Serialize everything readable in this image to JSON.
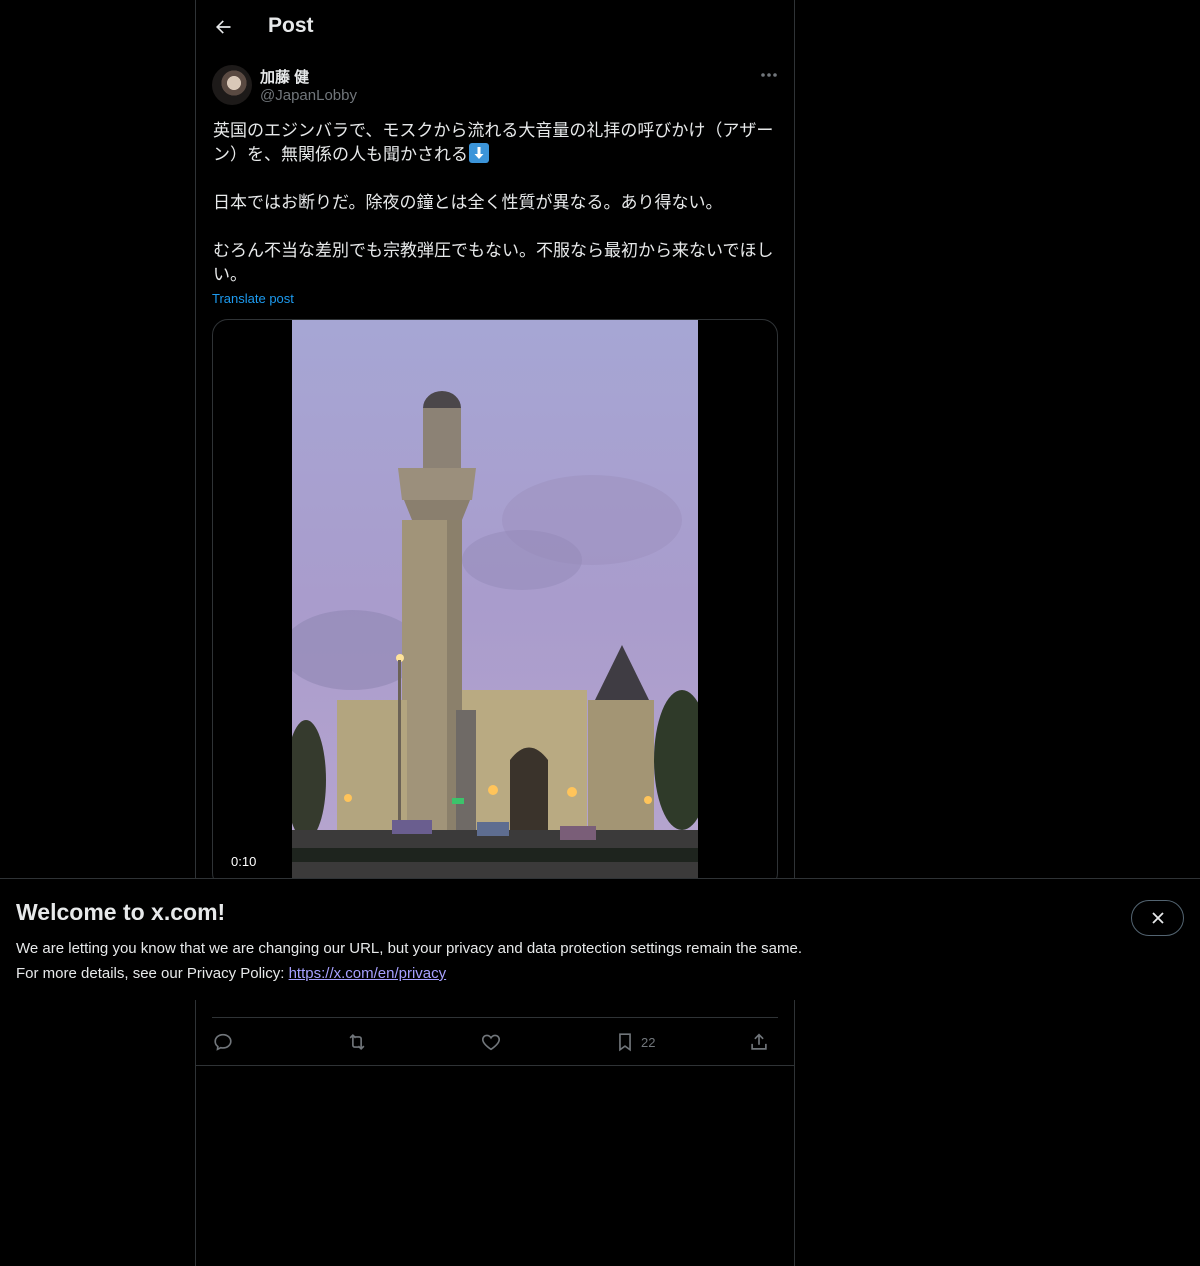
{
  "header": {
    "title": "Post",
    "back_icon": "arrow-left-icon"
  },
  "author": {
    "display_name": "加藤 健",
    "handle": "@JapanLobby"
  },
  "tweet": {
    "paragraph1": "英国のエジンバラで、モスクから流れる大音量の礼拝の呼びかけ（アザーン）を、無関係の人も聞かされる",
    "paragraph2": "日本ではお断りだ。除夜の鐘とは全く性質が異なる。あり得ない。",
    "paragraph3": "むろん不当な差別でも宗教弾圧でもない。不服なら最初から来ないでほしい。",
    "translate_label": "Translate post"
  },
  "media": {
    "duration": "0:10",
    "scene": "mosque-minaret-dusk"
  },
  "actions": {
    "reply_icon": "reply-icon",
    "repost_icon": "repost-icon",
    "like_icon": "heart-icon",
    "bookmark_icon": "bookmark-icon",
    "bookmark_count": "22",
    "share_icon": "share-icon"
  },
  "banner": {
    "title": "Welcome to x.com!",
    "line1": "We are letting you know that we are changing our URL, but your privacy and data protection settings remain the same.",
    "line2_prefix": "For more details, see our Privacy Policy: ",
    "link": "https://x.com/en/privacy"
  },
  "colors": {
    "background": "#000000",
    "text": "#e7e9ea",
    "muted": "#71767b",
    "link": "#1d9bf0",
    "border": "#2f3336"
  }
}
